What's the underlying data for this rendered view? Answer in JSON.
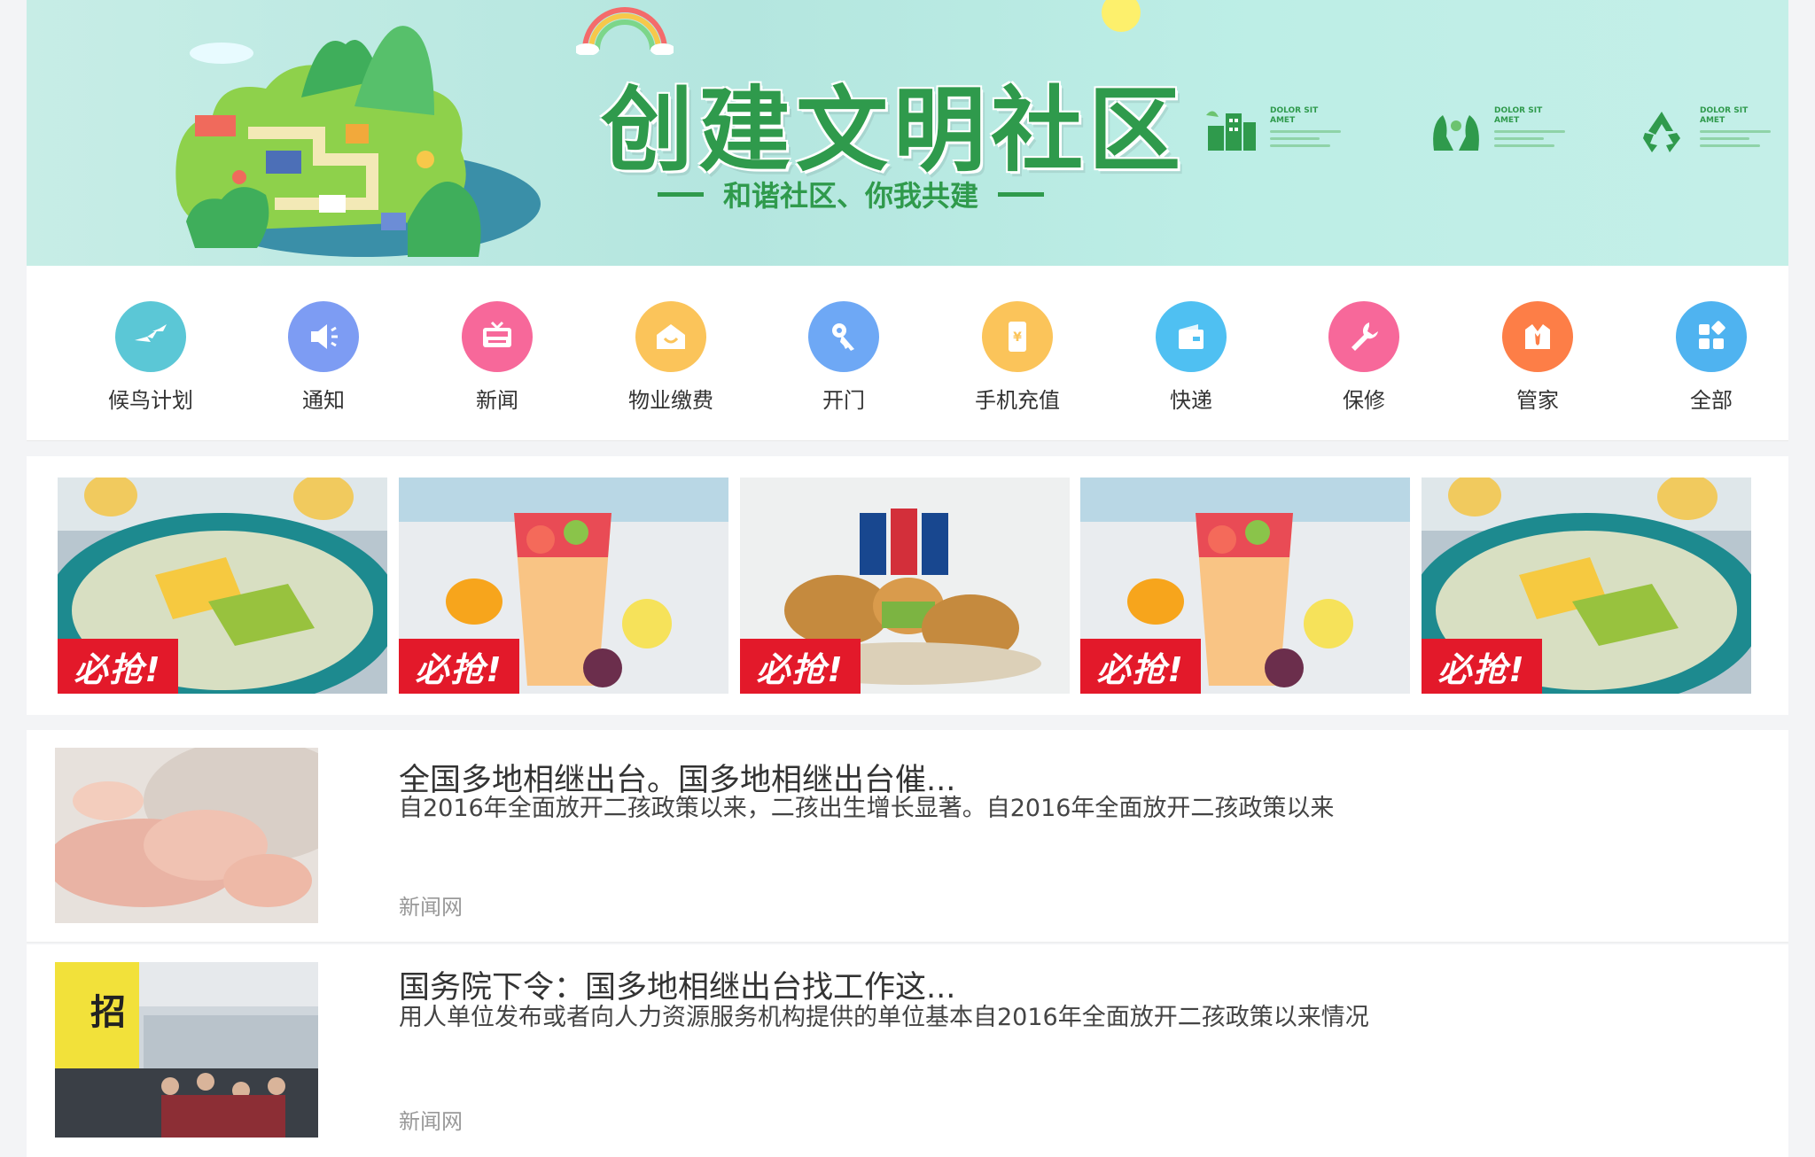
{
  "banner": {
    "title": "创建文明社区",
    "subtitle": "和谐社区、你我共建",
    "badges": [
      {
        "icon": "building-icon",
        "text": "DOLOR SIT AMET"
      },
      {
        "icon": "hands-icon",
        "text": "DOLOR SIT AMET"
      },
      {
        "icon": "recycle-icon",
        "text": "DOLOR SIT AMET"
      }
    ]
  },
  "services": [
    {
      "label": "候鸟计划",
      "icon": "birds-icon",
      "color": "#5bc7d6"
    },
    {
      "label": "通知",
      "icon": "megaphone-icon",
      "color": "#7d9cf3"
    },
    {
      "label": "新闻",
      "icon": "tv-news-icon",
      "color": "#f7689a"
    },
    {
      "label": "物业缴费",
      "icon": "house-icon",
      "color": "#fbc45a"
    },
    {
      "label": "开门",
      "icon": "key-icon",
      "color": "#6ea8f5"
    },
    {
      "label": "手机充值",
      "icon": "phone-icon",
      "color": "#fbc45a"
    },
    {
      "label": "快递",
      "icon": "package-icon",
      "color": "#4fc0f2"
    },
    {
      "label": "保修",
      "icon": "wrench-icon",
      "color": "#f7689a"
    },
    {
      "label": "管家",
      "icon": "butler-icon",
      "color": "#fd7e47"
    },
    {
      "label": "全部",
      "icon": "grid-icon",
      "color": "#4fb3f0"
    }
  ],
  "promos": [
    {
      "tag": "必抢!",
      "image": "crepe-dessert"
    },
    {
      "tag": "必抢!",
      "image": "fruit-tea"
    },
    {
      "tag": "必抢!",
      "image": "fried-chicken-combo"
    },
    {
      "tag": "必抢!",
      "image": "fruit-tea"
    },
    {
      "tag": "必抢!",
      "image": "crepe-dessert"
    }
  ],
  "news": [
    {
      "title": "全国多地相继出台。国多地相继出台催...",
      "description": "自2016年全面放开二孩政策以来，二孩出生增长显著。自2016年全面放开二孩政策以来",
      "source": "新闻网",
      "image": "baby-feet"
    },
    {
      "title": "国务院下令：国多地相继出台找工作这...",
      "description": "用人单位发布或者向人力资源服务机构提供的单位基本自2016年全面放开二孩政策以来情况",
      "source": "新闻网",
      "image": "job-fair"
    }
  ]
}
